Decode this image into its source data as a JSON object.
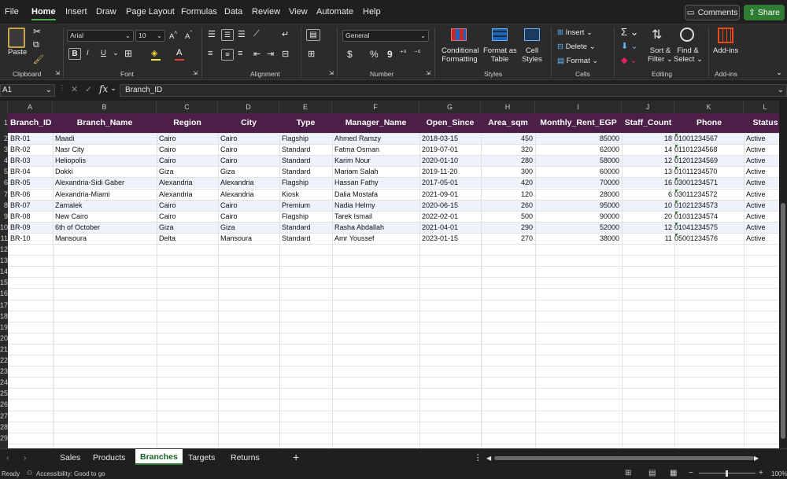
{
  "menu": {
    "items": [
      "File",
      "Home",
      "Insert",
      "Draw",
      "Page Layout",
      "Formulas",
      "Data",
      "Review",
      "View",
      "Automate",
      "Help"
    ],
    "active": "Home",
    "comments_label": "Comments",
    "share_label": "Share"
  },
  "ribbon": {
    "clipboard": {
      "label": "Clipboard",
      "paste": "Paste"
    },
    "font": {
      "label": "Font",
      "font_name": "Arial",
      "font_size": "10",
      "bold": "B",
      "italic": "I",
      "underline": "U"
    },
    "alignment": {
      "label": "Alignment"
    },
    "number": {
      "label": "Number",
      "format": "General",
      "currency": "$",
      "percent": "%",
      "comma": "9"
    },
    "styles": {
      "label": "Styles",
      "conditional_1": "Conditional",
      "conditional_2": "Formatting",
      "format_table_1": "Format as",
      "format_table_2": "Table",
      "cell_styles_1": "Cell",
      "cell_styles_2": "Styles"
    },
    "cells": {
      "label": "Cells",
      "insert": "Insert",
      "delete": "Delete",
      "format": "Format"
    },
    "editing": {
      "label": "Editing",
      "sort_1": "Sort &",
      "sort_2": "Filter",
      "find_1": "Find &",
      "find_2": "Select"
    },
    "addins": {
      "label": "Add-ins",
      "button": "Add-ins"
    }
  },
  "formula_bar": {
    "name_box": "A1",
    "content": "Branch_ID"
  },
  "columns": [
    "A",
    "B",
    "C",
    "D",
    "E",
    "F",
    "G",
    "H",
    "I",
    "J",
    "K",
    "L"
  ],
  "row_numbers": [
    "1",
    "2",
    "3",
    "4",
    "5",
    "6",
    "7",
    "8",
    "9",
    "10",
    "11",
    "12",
    "13",
    "14",
    "15",
    "16",
    "17",
    "18",
    "19",
    "20",
    "21",
    "22",
    "23",
    "24",
    "25",
    "26",
    "27",
    "28",
    "29"
  ],
  "table": {
    "headers": [
      "Branch_ID",
      "Branch_Name",
      "Region",
      "City",
      "Type",
      "Manager_Name",
      "Open_Since",
      "Area_sqm",
      "Monthly_Rent_EGP",
      "Staff_Count",
      "Phone",
      "Status"
    ],
    "rows": [
      [
        "BR-01",
        "Maadi",
        "Cairo",
        "Cairo",
        "Flagship",
        "Ahmed Ramzy",
        "2018-03-15",
        "450",
        "85000",
        "18",
        "01001234567",
        "Active"
      ],
      [
        "BR-02",
        "Nasr City",
        "Cairo",
        "Cairo",
        "Standard",
        "Fatma Osman",
        "2019-07-01",
        "320",
        "62000",
        "14",
        "01101234568",
        "Active"
      ],
      [
        "BR-03",
        "Heliopolis",
        "Cairo",
        "Cairo",
        "Standard",
        "Karim Nour",
        "2020-01-10",
        "280",
        "58000",
        "12",
        "01201234569",
        "Active"
      ],
      [
        "BR-04",
        "Dokki",
        "Giza",
        "Giza",
        "Standard",
        "Mariam Salah",
        "2019-11-20",
        "300",
        "60000",
        "13",
        "01011234570",
        "Active"
      ],
      [
        "BR-05",
        "Alexandria-Sidi Gaber",
        "Alexandria",
        "Alexandria",
        "Flagship",
        "Hassan Fathy",
        "2017-05-01",
        "420",
        "70000",
        "16",
        "03001234571",
        "Active"
      ],
      [
        "BR-06",
        "Alexandria-Miami",
        "Alexandria",
        "Alexandria",
        "Kiosk",
        "Dalia Mostafa",
        "2021-09-01",
        "120",
        "28000",
        "6",
        "03011234572",
        "Active"
      ],
      [
        "BR-07",
        "Zamalek",
        "Cairo",
        "Cairo",
        "Premium",
        "Nadia Helmy",
        "2020-06-15",
        "260",
        "95000",
        "10",
        "01021234573",
        "Active"
      ],
      [
        "BR-08",
        "New Cairo",
        "Cairo",
        "Cairo",
        "Flagship",
        "Tarek Ismail",
        "2022-02-01",
        "500",
        "90000",
        "20",
        "01031234574",
        "Active"
      ],
      [
        "BR-09",
        "6th of October",
        "Giza",
        "Giza",
        "Standard",
        "Rasha Abdallah",
        "2021-04-01",
        "290",
        "52000",
        "12",
        "01041234575",
        "Active"
      ],
      [
        "BR-10",
        "Mansoura",
        "Delta",
        "Mansoura",
        "Standard",
        "Amr Youssef",
        "2023-01-15",
        "270",
        "38000",
        "11",
        "05001234576",
        "Active"
      ]
    ]
  },
  "sheets": [
    "Sales",
    "Products",
    "Branches",
    "Targets",
    "Returns"
  ],
  "active_sheet": "Branches",
  "status": {
    "ready": "Ready",
    "accessibility": "Accessibility: Good to go",
    "zoom": "100%"
  },
  "colors": {
    "header_bg": "#4b1f47",
    "band_bg": "#eef2fb",
    "accent": "#2e7d32"
  }
}
